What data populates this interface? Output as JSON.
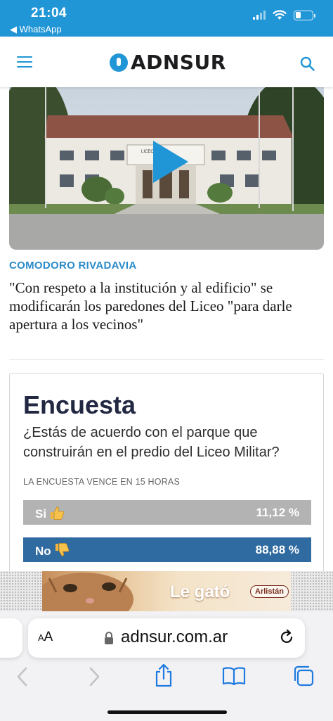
{
  "status_bar": {
    "time": "21:04",
    "back_app": "◀ WhatsApp",
    "background": "#2196d6"
  },
  "header": {
    "logo_text": "ADNSUR",
    "brand_color": "#2196d6"
  },
  "article": {
    "category": "COMODORO RIVADAVIA",
    "headline": "\"Con respeto a la institución y al edificio\" se modificarán los paredones del Liceo \"para darle apertura a los vecinos\"",
    "building_sign": "LICEO",
    "has_video": true
  },
  "poll": {
    "title": "Encuesta",
    "question": "¿Estás de acuerdo con el parque que construirán en el predio del Liceo Militar?",
    "expiry": "LA ENCUESTA VENCE EN 15 HORAS",
    "options": [
      {
        "label": "Si",
        "icon": "thumbs-up-icon",
        "percent_text": "11,12 %",
        "percent": 11.12,
        "color": "#b3b3b3"
      },
      {
        "label": "No",
        "icon": "thumbs-down-icon",
        "percent_text": "88,88 %",
        "percent": 88.88,
        "color": "#2f6aa0"
      }
    ]
  },
  "ad": {
    "text": "Le gató",
    "brand": "Arlistán"
  },
  "browser": {
    "aa_label_small": "A",
    "aa_label_large": "A",
    "url": "adnsur.com.ar"
  }
}
